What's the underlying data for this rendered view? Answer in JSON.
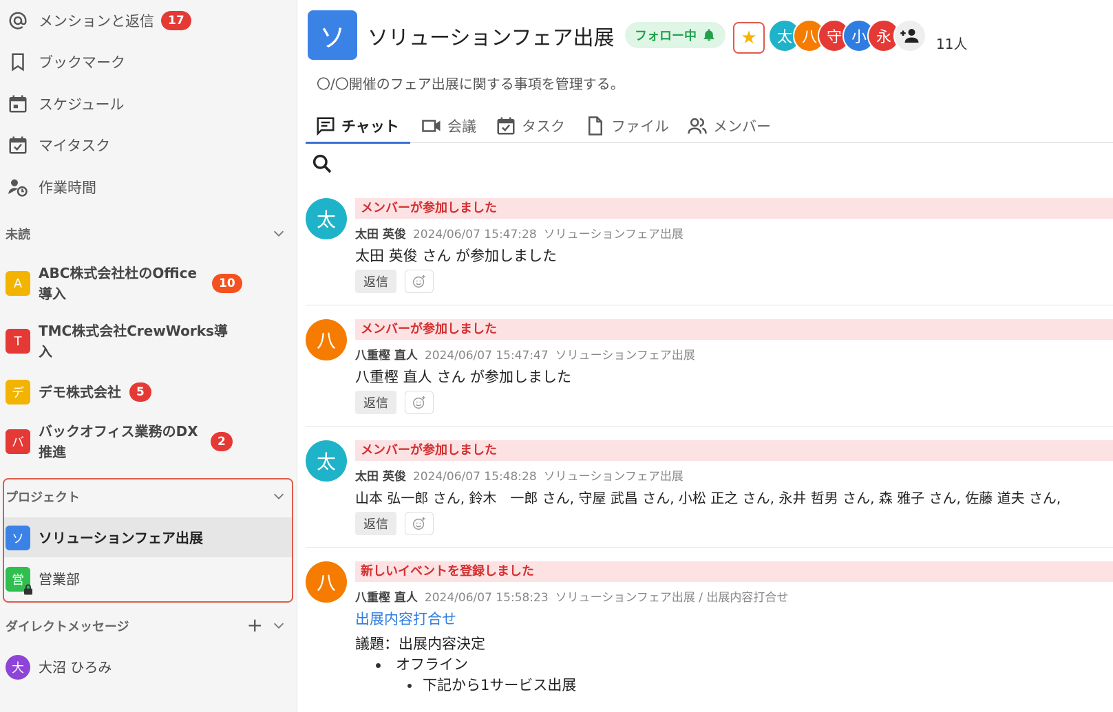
{
  "sidebar": {
    "nav": [
      {
        "label": "メンションと返信",
        "badge": "17",
        "icon": "at-icon"
      },
      {
        "label": "ブックマーク",
        "icon": "bookmark-icon"
      },
      {
        "label": "スケジュール",
        "icon": "calendar-icon"
      },
      {
        "label": "マイタスク",
        "icon": "task-icon"
      },
      {
        "label": "作業時間",
        "icon": "work-time-icon"
      }
    ],
    "unread_label": "未読",
    "unread": [
      {
        "initial": "A",
        "name_line1": "ABC株式会社杜のOffice",
        "name_line2": "導入",
        "badge": "10",
        "color": "#f2b400"
      },
      {
        "initial": "T",
        "name_line1": "TMC株式会社CrewWorks導",
        "name_line2": "入",
        "color": "#e53935"
      },
      {
        "initial": "デ",
        "name_line1": "デモ株式会社",
        "badge": "5",
        "color": "#f2b400"
      },
      {
        "initial": "バ",
        "name_line1": "バックオフィス業務のDX",
        "name_line2": "推進",
        "badge": "2",
        "color": "#e53935"
      }
    ],
    "projects_label": "プロジェクト",
    "projects": [
      {
        "initial": "ソ",
        "name": "ソリューションフェア出展",
        "color": "#3b82e6"
      },
      {
        "initial": "営",
        "name": "営業部",
        "color": "#2fbf4f"
      }
    ],
    "dm_label": "ダイレクトメッセージ",
    "dms": [
      {
        "initial": "大",
        "name": "大沼 ひろみ",
        "color": "#8e44d6"
      }
    ]
  },
  "header": {
    "avatar_initial": "ソ",
    "title": "ソリューションフェア出展",
    "follow_label": "フォロー中",
    "star_glyph": "★",
    "members": [
      {
        "initial": "太",
        "color": "#1fb3c9"
      },
      {
        "initial": "八",
        "color": "#f57c00"
      },
      {
        "initial": "守",
        "color": "#e53935"
      },
      {
        "initial": "小",
        "color": "#2f7de1"
      },
      {
        "initial": "永",
        "color": "#e53935"
      }
    ],
    "member_count": "11人",
    "description": "〇/〇開催のフェア出展に関する事項を管理する。"
  },
  "tabs": [
    {
      "label": "チャット",
      "icon": "chat-icon"
    },
    {
      "label": "会議",
      "icon": "video-icon"
    },
    {
      "label": "タスク",
      "icon": "task-icon"
    },
    {
      "label": "ファイル",
      "icon": "file-icon"
    },
    {
      "label": "メンバー",
      "icon": "members-icon"
    }
  ],
  "messages": [
    {
      "initial": "太",
      "color": "#1fb3c9",
      "banner": "メンバーが参加しました",
      "author": "太田 英俊",
      "time": "2024/06/07 15:47:28",
      "channel": "ソリューションフェア出展",
      "text": "太田 英俊 さん が参加しました",
      "reply": "返信"
    },
    {
      "initial": "八",
      "color": "#f57c00",
      "banner": "メンバーが参加しました",
      "author": "八重樫 直人",
      "time": "2024/06/07 15:47:47",
      "channel": "ソリューションフェア出展",
      "text": "八重樫 直人 さん が参加しました",
      "reply": "返信"
    },
    {
      "initial": "太",
      "color": "#1fb3c9",
      "banner": "メンバーが参加しました",
      "author": "太田 英俊",
      "time": "2024/06/07 15:48:28",
      "channel": "ソリューションフェア出展",
      "text": "山本 弘一郎 さん, 鈴木　一郎 さん, 守屋 武昌 さん, 小松 正之 さん, 永井 哲男 さん, 森 雅子 さん, 佐藤 道夫 さん,",
      "reply": "返信"
    },
    {
      "initial": "八",
      "color": "#f57c00",
      "banner": "新しいイベントを登録しました",
      "author": "八重樫 直人",
      "time": "2024/06/07 15:58:23",
      "channel": "ソリューションフェア出展 / 出展内容打合せ",
      "link": "出展内容打合せ",
      "agenda": "議題：出展内容決定",
      "bullet1": "オフライン",
      "bullet2": "下記から1サービス出展"
    }
  ]
}
